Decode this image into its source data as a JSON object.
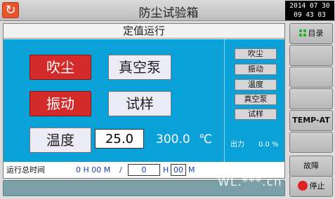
{
  "header": {
    "title": "防尘试验箱",
    "date": "2014 07 30",
    "time": "09 43 03"
  },
  "panel": {
    "title": "定值运行",
    "buttons": {
      "dust": "吹尘",
      "vacuum": "真空泵",
      "vibration": "振动",
      "sample": "试样"
    },
    "temperature": {
      "label": "温度",
      "setpoint": "25.0",
      "current": "300.0",
      "unit": "℃"
    },
    "indicators": [
      "吹尘",
      "振动",
      "温度",
      "真空泵",
      "试样"
    ],
    "output": {
      "label": "出力",
      "value": "0.0 %"
    }
  },
  "runtime": {
    "label": "运行总时间",
    "elapsed": "0 H 00 M",
    "separator": "/",
    "hours_value": "0",
    "h_label": "H",
    "minutes_value": "00",
    "m_label": "M"
  },
  "sidebar": {
    "menu": "目录",
    "temp": "TEMP-AT",
    "fault": "故障",
    "stop": "停止"
  },
  "watermark": "WL.***.cn",
  "colors": {
    "accent_blue": "#0aa0d8",
    "active_red": "#d42a2a",
    "home_orange": "#e8552c"
  }
}
